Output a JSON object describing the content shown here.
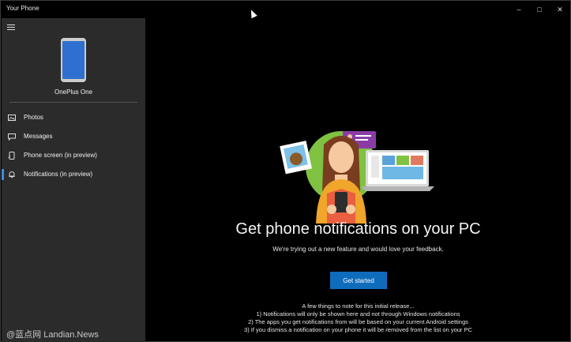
{
  "window": {
    "title": "Your Phone",
    "controls": [
      "–",
      "□",
      "✕"
    ]
  },
  "sidebar": {
    "device_name": "OnePlus One",
    "items": [
      {
        "label": "Photos",
        "icon": "photos-icon"
      },
      {
        "label": "Messages",
        "icon": "messages-icon"
      },
      {
        "label": "Phone screen (in preview)",
        "icon": "phone-screen-icon"
      },
      {
        "label": "Notifications (in preview)",
        "icon": "notifications-icon",
        "active": true
      }
    ]
  },
  "main": {
    "heading": "Get phone notifications on your PC",
    "subtitle": "We're trying out a new feature and would love your feedback.",
    "button_label": "Get started",
    "notes": [
      "A few things to note for this initial release...",
      "1) Notifications will only be shown here and not through Windows notifications",
      "2) The apps you get notifications from will be based on your current Android settings",
      "3) If you dismiss a notification on your phone it will be removed from the list on your PC"
    ]
  },
  "watermark": "@蓝点网 Landian.News",
  "colors": {
    "accent": "#0f6cbd",
    "sidebar": "#2b2b2b",
    "background": "#000000"
  }
}
